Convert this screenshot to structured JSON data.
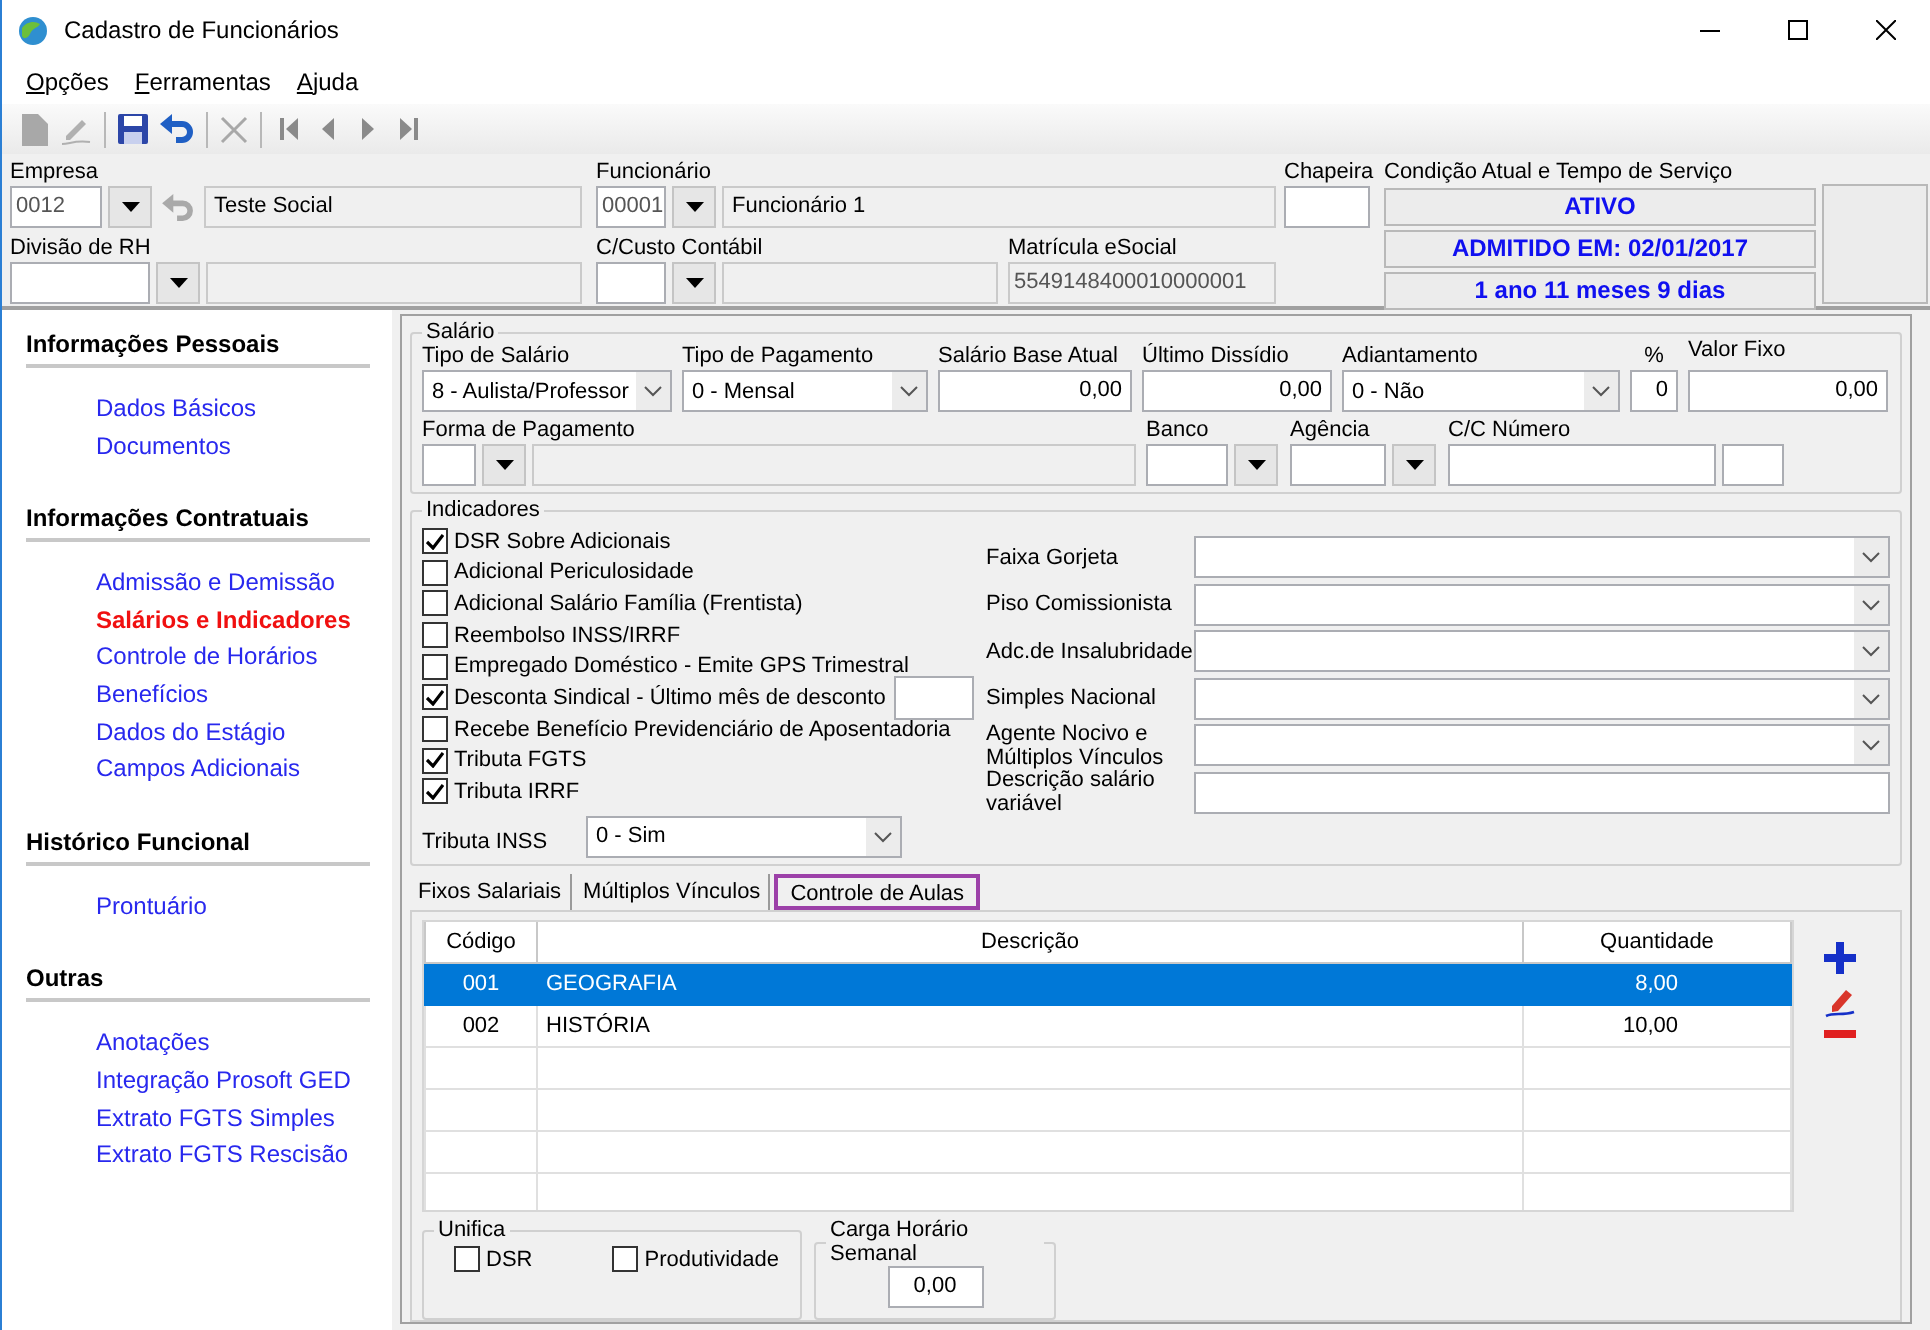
{
  "window": {
    "title": "Cadastro de Funcionários"
  },
  "menu": [
    "Opções",
    "Ferramentas",
    "Ajuda"
  ],
  "toolbar_groups": [
    [
      {
        "kind": "new",
        "disabled": true
      },
      {
        "kind": "edit",
        "disabled": true
      }
    ],
    [
      {
        "kind": "save",
        "disabled": false
      },
      {
        "kind": "undo",
        "disabled": false
      }
    ],
    [
      {
        "kind": "delete",
        "disabled": true
      }
    ],
    [
      {
        "kind": "first",
        "disabled": true
      },
      {
        "kind": "prev",
        "disabled": true
      },
      {
        "kind": "next",
        "disabled": true
      },
      {
        "kind": "last",
        "disabled": true
      }
    ]
  ],
  "header": {
    "empresa": {
      "label": "Empresa",
      "code": "0012",
      "name": "Teste Social"
    },
    "divisao_rh": {
      "label": "Divisão de RH"
    },
    "funcionario": {
      "label": "Funcionário",
      "code": "00001",
      "name": "Funcionário 1"
    },
    "c_custo": {
      "label": "C/Custo Contábil"
    },
    "matricula": {
      "label": "Matrícula eSocial",
      "value": "5549148400010000001"
    },
    "chapeira": {
      "label": "Chapeira"
    },
    "condicao": {
      "label": "Condição Atual e Tempo de Serviço",
      "lines": [
        "ATIVO",
        "ADMITIDO EM: 02/01/2017",
        "1 ano 11 meses 9 dias"
      ]
    }
  },
  "sidebar": [
    {
      "title": "Informações Pessoais",
      "items": [
        {
          "label": "Dados Básicos",
          "selected": false
        },
        {
          "label": "Documentos",
          "selected": false
        }
      ]
    },
    {
      "title": "Informações Contratuais",
      "items": [
        {
          "label": "Admissão e Demissão",
          "selected": false
        },
        {
          "label": "Salários e Indicadores",
          "selected": true
        },
        {
          "label": "Controle de Horários",
          "selected": false
        },
        {
          "label": "Benefícios",
          "selected": false
        },
        {
          "label": "Dados do Estágio",
          "selected": false
        },
        {
          "label": "Campos Adicionais",
          "selected": false
        }
      ]
    },
    {
      "title": "Histórico Funcional",
      "items": [
        {
          "label": "Prontuário",
          "selected": false
        }
      ]
    },
    {
      "title": "Outras",
      "items": [
        {
          "label": "Anotações",
          "selected": false
        },
        {
          "label": "Integração Prosoft GED",
          "selected": false
        },
        {
          "label": "Extrato FGTS Simples",
          "selected": false
        },
        {
          "label": "Extrato FGTS Rescisão",
          "selected": false
        }
      ]
    }
  ],
  "salario": {
    "title": "Salário",
    "tipo_salario": {
      "label": "Tipo de Salário",
      "value": "8 - Aulista/Professor"
    },
    "tipo_pagamento": {
      "label": "Tipo de Pagamento",
      "value": "0 - Mensal"
    },
    "salario_base": {
      "label": "Salário Base Atual",
      "value": "0,00"
    },
    "ultimo_dissidio": {
      "label": "Último Dissídio",
      "value": "0,00"
    },
    "adiantamento": {
      "label": "Adiantamento",
      "value": "0 - Não"
    },
    "percentual": {
      "label": "%",
      "value": "0"
    },
    "valor_fixo": {
      "label": "Valor Fixo",
      "value": "0,00"
    },
    "forma_pagamento": {
      "label": "Forma de Pagamento"
    },
    "banco": {
      "label": "Banco"
    },
    "agencia": {
      "label": "Agência"
    },
    "cc_numero": {
      "label": "C/C Número"
    }
  },
  "indicadores": {
    "title": "Indicadores",
    "checks": [
      {
        "kind": "check",
        "label": "DSR Sobre Adicionais",
        "checked": true
      },
      {
        "kind": "check",
        "label": "Adicional Periculosidade",
        "checked": false
      },
      {
        "kind": "check",
        "label": "Adicional Salário Família (Frentista)",
        "checked": false
      },
      {
        "kind": "check",
        "label": "Reembolso INSS/IRRF",
        "checked": false
      },
      {
        "kind": "check",
        "label": "Empregado Doméstico - Emite GPS Trimestral",
        "checked": false
      },
      {
        "kind": "check_field",
        "label": "Desconta Sindical - Último mês de desconto",
        "checked": true
      },
      {
        "kind": "check",
        "label": "Recebe Benefício Previdenciário de Aposentadoria",
        "checked": false
      },
      {
        "kind": "check",
        "label": "Tributa FGTS",
        "checked": true
      },
      {
        "kind": "check",
        "label": "Tributa IRRF",
        "checked": true
      }
    ],
    "tributa_inss": {
      "label": "Tributa INSS",
      "value": "0 - Sim"
    },
    "fields": [
      {
        "kind": "select",
        "label": "Faixa Gorjeta"
      },
      {
        "kind": "select",
        "label": "Piso Comissionista"
      },
      {
        "kind": "select",
        "label": "Adc.de Insalubridade"
      },
      {
        "kind": "select",
        "label": "Simples Nacional"
      },
      {
        "kind": "select",
        "label": "Agente Nocivo e Múltiplos Vínculos"
      },
      {
        "kind": "text",
        "label": "Descrição salário variável"
      }
    ]
  },
  "tabs": [
    {
      "label": "Fixos Salariais",
      "selected": false
    },
    {
      "label": "Múltiplos Vínculos",
      "selected": false
    },
    {
      "label": "Controle de Aulas",
      "selected": true
    }
  ],
  "table": {
    "columns": [
      "Código",
      "Descrição",
      "Quantidade"
    ],
    "rows": [
      {
        "cells": [
          "001",
          "GEOGRAFIA",
          "8,00"
        ],
        "selected": true
      },
      {
        "cells": [
          "002",
          "HISTÓRIA",
          "10,00"
        ],
        "selected": false
      }
    ]
  },
  "unifica": {
    "title": "Unifica",
    "checks": [
      {
        "label": "DSR",
        "checked": false
      },
      {
        "label": "Produtividade",
        "checked": false
      }
    ]
  },
  "carga": {
    "title": "Carga Horário Semanal",
    "value": "0,00"
  }
}
